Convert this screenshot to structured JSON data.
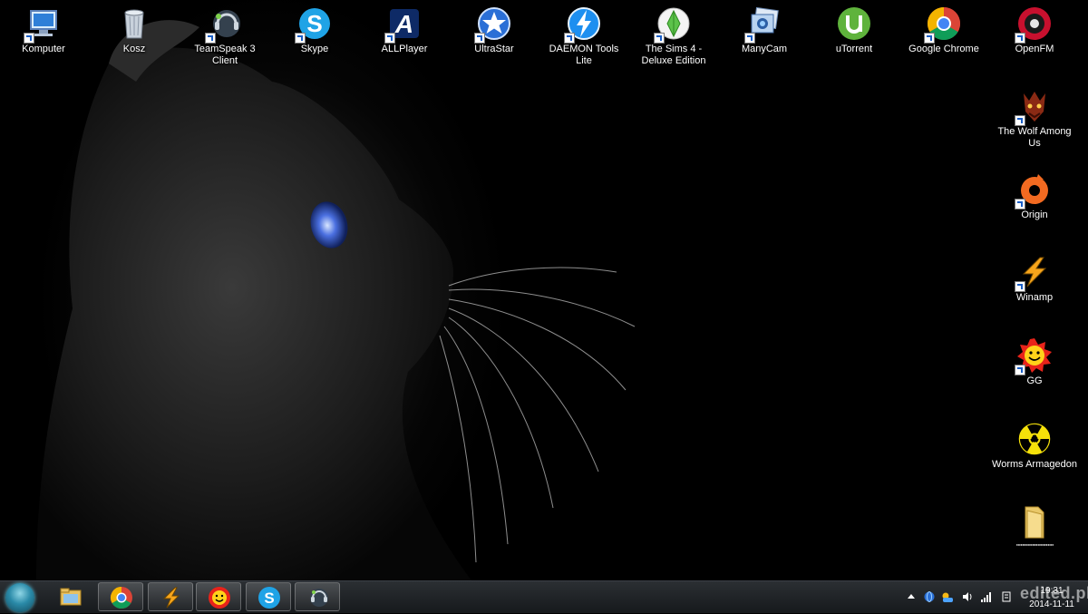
{
  "desktop": {
    "icons": [
      {
        "label": "Komputer",
        "icon": "computer-icon"
      },
      {
        "label": "Kosz",
        "icon": "recycle-bin-icon"
      },
      {
        "label": "TeamSpeak 3 Client",
        "icon": "teamspeak-icon"
      },
      {
        "label": "Skype",
        "icon": "skype-icon"
      },
      {
        "label": "ALLPlayer",
        "icon": "allplayer-icon"
      },
      {
        "label": "UltraStar",
        "icon": "ultrastar-icon"
      },
      {
        "label": "DAEMON Tools Lite",
        "icon": "daemon-tools-icon"
      },
      {
        "label": "The Sims 4 - Deluxe Edition",
        "icon": "sims-icon"
      },
      {
        "label": "ManyCam",
        "icon": "manycam-icon"
      },
      {
        "label": "uTorrent",
        "icon": "utorrent-icon"
      },
      {
        "label": "Google Chrome",
        "icon": "chrome-icon"
      },
      {
        "label": "OpenFM",
        "icon": "openfm-icon"
      },
      {
        "label": "The Wolf Among Us",
        "icon": "wolf-among-us-icon"
      },
      {
        "label": "Origin",
        "icon": "origin-icon"
      },
      {
        "label": "Winamp",
        "icon": "winamp-icon"
      },
      {
        "label": "GG",
        "icon": "gg-icon"
      },
      {
        "label": "Worms Armagedon",
        "icon": "radiation-icon"
      },
      {
        "label": "\"\"\"\"\"\"\"\"\"\"\"\"\"\"\"\"\"\"\"\"\"\"",
        "icon": "folder-icon"
      }
    ]
  },
  "taskbar": {
    "pinned": [
      {
        "icon": "file-explorer-icon"
      },
      {
        "icon": "chrome-icon"
      },
      {
        "icon": "winamp-icon"
      },
      {
        "icon": "gg-icon"
      },
      {
        "icon": "skype-icon"
      },
      {
        "icon": "teamspeak-icon"
      }
    ],
    "clock": {
      "time": "19:31",
      "date": "2014-11-11"
    }
  },
  "watermark": "edited.pl",
  "colors": {
    "taskbar": "#1c1f22",
    "accent": "#2a8aa8"
  }
}
